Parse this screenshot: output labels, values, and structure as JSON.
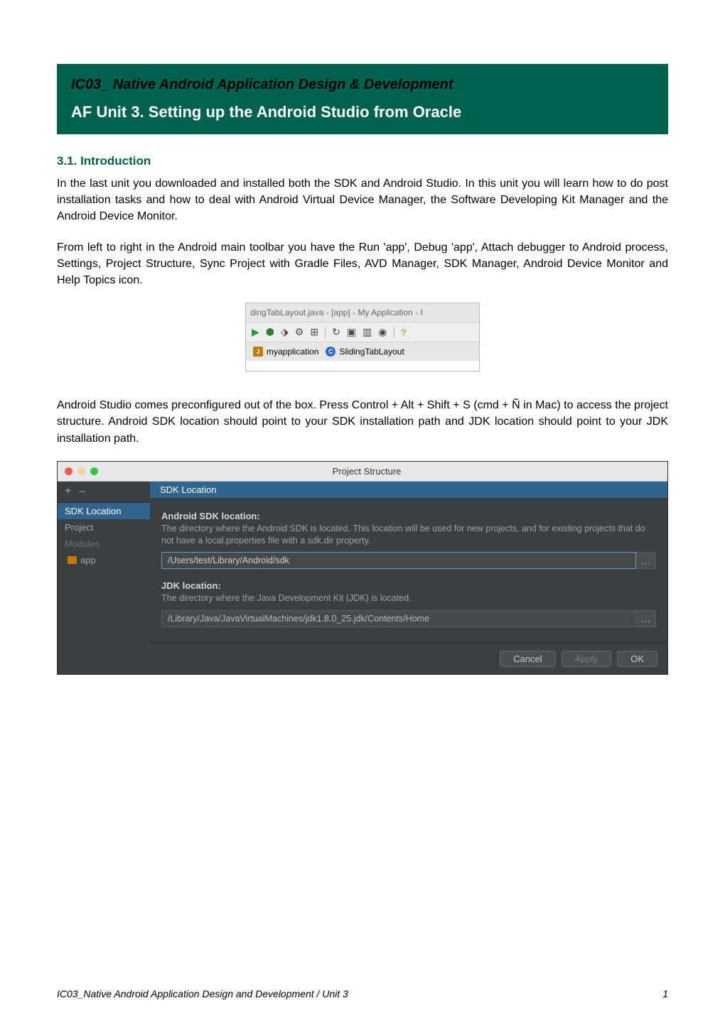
{
  "header": {
    "title": "IC03_ Native Android Application Design & Development",
    "subtitle": "AF Unit 3.  Setting up the Android Studio from Oracle"
  },
  "section_heading": "3.1. Introduction",
  "paragraph1": "In the last unit you downloaded and installed both the SDK and Android Studio. In this unit you will learn how to do post installation tasks and how to deal with Android Virtual Device Manager, the Software Developing Kit Manager and the Android Device Monitor.",
  "paragraph2": "From left to right in the Android main toolbar you have the Run 'app', Debug 'app', Attach debugger to Android process, Settings, Project Structure, Sync Project with Gradle Files, AVD Manager, SDK Manager, Android Device Monitor and Help Topics icon.",
  "toolbar_image": {
    "window_title": "dingTabLayout.java - [app] - My Application - I",
    "tab1": "myapplication",
    "tab2": "SlidingTabLayout"
  },
  "paragraph3": "Android Studio comes preconfigured out of the box. Press Control + Alt + Shift + S (cmd + Ñ in Mac) to access the project structure. Android SDK location should point to your SDK installation path and JDK location should point to your JDK installation path.",
  "project_structure": {
    "title": "Project Structure",
    "sidebar": {
      "items": [
        "SDK Location",
        "Project",
        "Modules",
        "app"
      ]
    },
    "main_header": "SDK Location",
    "sdk": {
      "label": "Android SDK location:",
      "desc": "The directory where the Android SDK is located. This location will be used for new projects, and for existing projects that do not have a local.properties file with a sdk.dir property.",
      "value": "/Users/test/Library/Android/sdk"
    },
    "jdk": {
      "label": "JDK location:",
      "desc": "The directory where the Java Development Kit (JDK) is located.",
      "value": "/Library/Java/JavaVirtualMachines/jdk1.8.0_25.jdk/Contents/Home"
    },
    "buttons": {
      "cancel": "Cancel",
      "apply": "Apply",
      "ok": "OK"
    }
  },
  "footer": {
    "left": "IC03_Native Android Application Design and Development  /  Unit 3",
    "right": "1"
  }
}
